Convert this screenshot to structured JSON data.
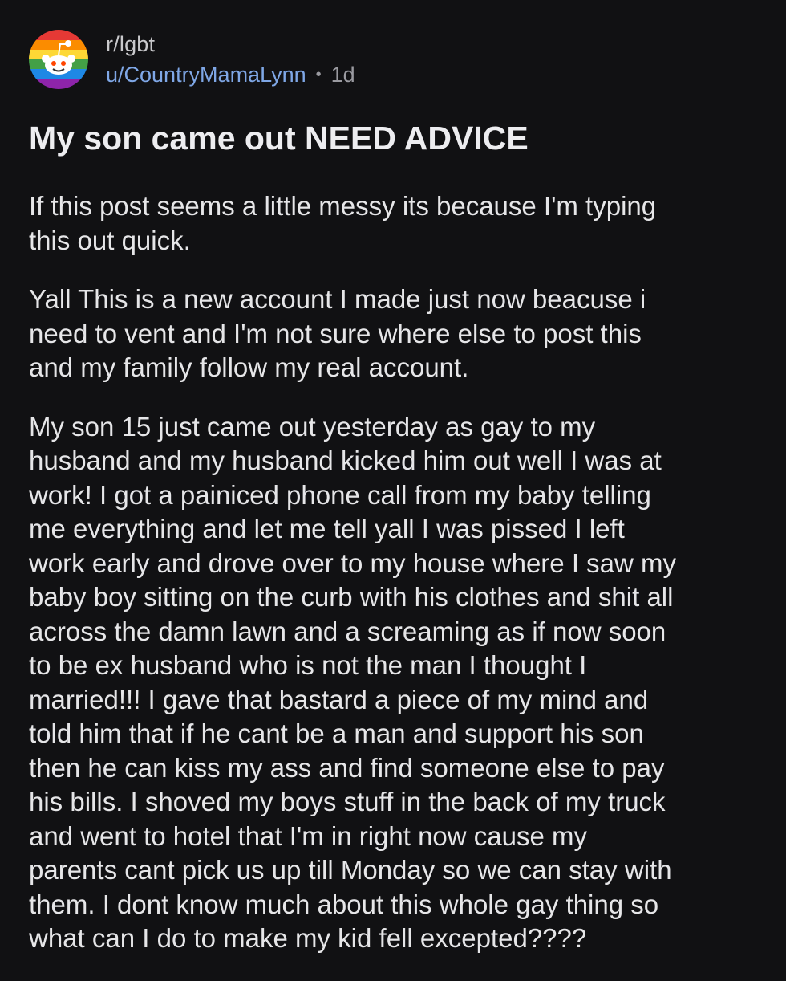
{
  "post": {
    "subreddit": "r/lgbt",
    "username": "u/CountryMamaLynn",
    "separator": "•",
    "age": "1d",
    "avatar_icon": "rainbow-snoo-avatar-icon",
    "title": "My son came out NEED ADVICE",
    "body": [
      "If this post seems a little messy its because I'm typing\nthis out quick.",
      "Yall This is a new account I made just now beacuse i\nneed to vent and I'm not sure where else to post this\nand my family follow my real  account.",
      "My son 15 just came out yesterday as gay to my\nhusband and my husband kicked him out well I was at\nwork! I got a painiced phone call from my baby telling\nme everything and let me tell yall I was pissed I left\nwork early and drove over to my house where I saw my\nbaby boy sitting on the curb with his clothes and shit all\nacross the damn lawn and a screaming as if now soon\nto be ex husband who is not the man I thought I\nmarried!!! I gave that bastard a piece of my mind and\ntold him that if he cant be a man and support his son\nthen he can kiss my ass and find someone else to pay\nhis bills. I shoved my boys stuff in the back of my truck\nand went to hotel that I'm in right now cause my\nparents cant pick us up till Monday so we can stay with\nthem. I dont know much about this whole gay thing so\nwhat can I do to make my kid fell excepted????"
    ]
  },
  "colors": {
    "background": "#111113",
    "username": "#7fa7e6",
    "text": "#e6e6e8"
  }
}
